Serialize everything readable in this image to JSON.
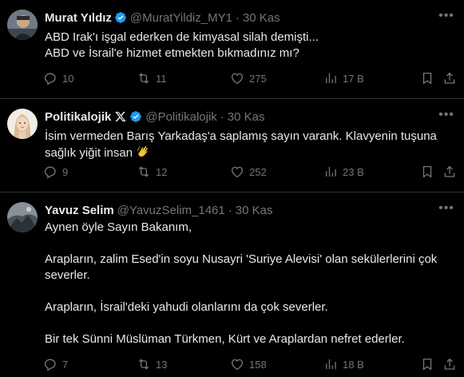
{
  "tweets": [
    {
      "name": "Murat Yıldız",
      "verified": true,
      "handle": "@MuratYildiz_MY1",
      "dot": "·",
      "time": "30 Kas",
      "lines": [
        "ABD Irak'ı işgal ederken de kimyasal silah demişti...",
        "ABD ve İsrail'e hizmet etmekten bıkmadınız mı?"
      ],
      "replies": "10",
      "retweets": "11",
      "likes": "275",
      "views": "17 B"
    },
    {
      "name": "Politikalojik",
      "verified": true,
      "handle": "@Politikalojik",
      "dot": "·",
      "time": "30 Kas",
      "lines": [
        "İsim vermeden Barış Yarkadaş'a saplamış sayın varank. Klavyenin tuşuna",
        "sağlık yiğit insan"
      ],
      "replies": "9",
      "retweets": "12",
      "likes": "252",
      "views": "23 B"
    },
    {
      "name": "Yavuz Selim",
      "verified": false,
      "handle": "@YavuzSelim_1461",
      "dot": "·",
      "time": "30 Kas",
      "lines": [
        "Aynen öyle Sayın Bakanım,",
        "Arapların, zalim Esed'in soyu Nusayri 'Suriye Alevisi' olan sekülerlerini çok",
        "severler.",
        "Arapların, İsrail'deki yahudi olanlarını da çok severler.",
        "Bir tek Sünni Müslüman Türkmen, Kürt ve Araplardan nefret ederler."
      ],
      "replies": "7",
      "retweets": "13",
      "likes": "158",
      "views": "18 B"
    }
  ],
  "icons": {
    "reply": "reply-icon",
    "retweet": "retweet-icon",
    "like": "heart-icon",
    "views": "views-icon",
    "bookmark": "bookmark-icon",
    "share": "share-icon",
    "more": "more-icon",
    "verified": "verified-badge-icon",
    "x_logo": "x-logo-icon",
    "clap": "clap-emoji-icon"
  },
  "colors": {
    "background": "#000000",
    "text": "#e7e9ea",
    "muted": "#71767b",
    "verified": "#1d9bf0",
    "divider": "#2f3336"
  }
}
